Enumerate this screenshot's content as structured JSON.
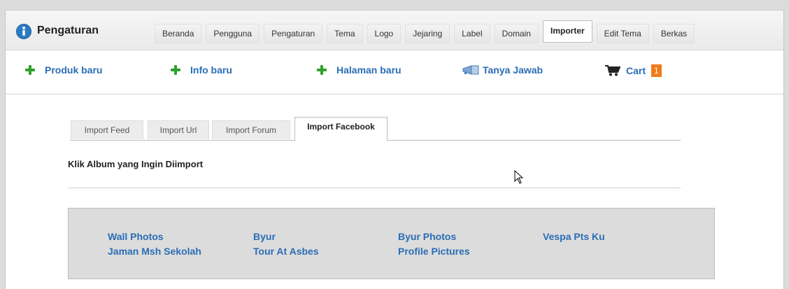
{
  "app": {
    "title": "Pengaturan"
  },
  "nav": {
    "tabs": [
      {
        "label": "Beranda"
      },
      {
        "label": "Pengguna"
      },
      {
        "label": "Pengaturan"
      },
      {
        "label": "Tema"
      },
      {
        "label": "Logo"
      },
      {
        "label": "Jejaring"
      },
      {
        "label": "Label"
      },
      {
        "label": "Domain"
      },
      {
        "label": "Importer",
        "active": true
      },
      {
        "label": "Edit Tema"
      },
      {
        "label": "Berkas"
      }
    ]
  },
  "actions": {
    "new_product": "Produk baru",
    "new_info": "Info baru",
    "new_page": "Halaman baru",
    "faq": "Tanya Jawab",
    "cart": "Cart",
    "cart_count": "1"
  },
  "import_tabs": [
    {
      "label": "Import Feed"
    },
    {
      "label": "Import Url"
    },
    {
      "label": "Import Forum"
    },
    {
      "label": "Import Facebook",
      "active": true
    }
  ],
  "section": {
    "heading": "Klik Album yang Ingin Diimport"
  },
  "albums": [
    "Wall Photos",
    "Byur",
    "Byur Photos",
    "Vespa Pts Ku",
    "Jaman Msh Sekolah",
    "Tour At Asbes",
    "Profile Pictures"
  ],
  "colors": {
    "link": "#2a6db5",
    "plus_icon": "#2ea12e",
    "badge": "#f07b1a",
    "logo": "#2a7bc3"
  }
}
